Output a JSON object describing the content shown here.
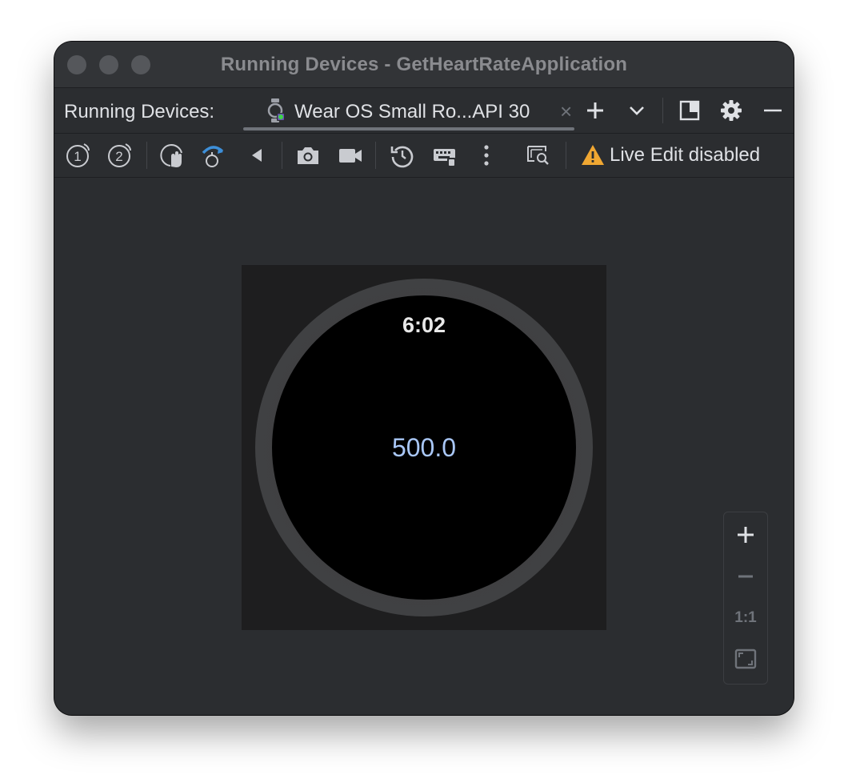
{
  "window": {
    "title": "Running Devices - GetHeartRateApplication"
  },
  "tabbar": {
    "label": "Running Devices:",
    "tab": {
      "name": "Wear OS Small Ro...API 30",
      "close": "×"
    }
  },
  "toolbar": {
    "live_edit": "Live Edit disabled",
    "icons": [
      "wear-button-1-icon",
      "wear-button-2-icon",
      "palm-gesture-icon",
      "tilt-gesture-icon",
      "back-icon",
      "screenshot-camera-icon",
      "screen-record-icon",
      "reset-icon",
      "keyboard-icon",
      "more-options-icon",
      "layout-inspector-icon",
      "warning-icon"
    ]
  },
  "device": {
    "time": "6:02",
    "value": "500.0"
  },
  "zoom": {
    "actual_size": "1:1"
  },
  "colors": {
    "window_bg": "#2b2d30",
    "value_text": "#a9c7f7",
    "warning": "#f0a732",
    "accent_blue": "#3d8fd9"
  }
}
